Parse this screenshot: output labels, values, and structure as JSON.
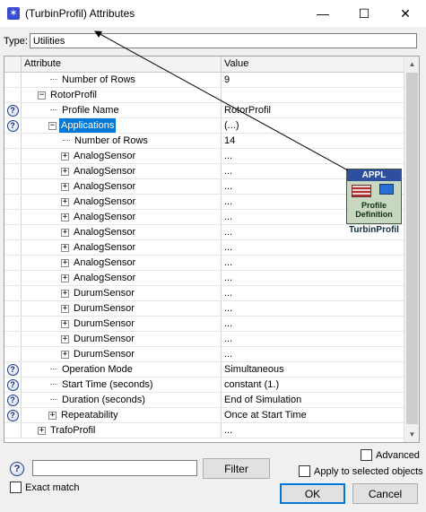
{
  "window": {
    "title": "(TurbinProfil) Attributes",
    "minimize": "—",
    "maximize": "☐",
    "close": "✕"
  },
  "type_row": {
    "label": "Type:",
    "value": "Utilities"
  },
  "grid": {
    "columns": {
      "attribute": "Attribute",
      "value": "Value"
    },
    "rows": [
      {
        "q": false,
        "indent": 3,
        "expander": "",
        "label": "Number of Rows",
        "value": "9",
        "selected": false
      },
      {
        "q": false,
        "indent": 2,
        "expander": "minus",
        "label": "RotorProfil",
        "value": "",
        "selected": false
      },
      {
        "q": true,
        "indent": 3,
        "expander": "",
        "label": "Profile Name",
        "value": "RotorProfil",
        "selected": false
      },
      {
        "q": true,
        "indent": 3,
        "expander": "minus",
        "label": "Applications",
        "value": "(...)",
        "selected": true
      },
      {
        "q": false,
        "indent": 4,
        "expander": "",
        "label": "Number of Rows",
        "value": "14",
        "selected": false
      },
      {
        "q": false,
        "indent": 4,
        "expander": "plus",
        "label": "AnalogSensor",
        "value": "...",
        "selected": false
      },
      {
        "q": false,
        "indent": 4,
        "expander": "plus",
        "label": "AnalogSensor",
        "value": "...",
        "selected": false
      },
      {
        "q": false,
        "indent": 4,
        "expander": "plus",
        "label": "AnalogSensor",
        "value": "...",
        "selected": false
      },
      {
        "q": false,
        "indent": 4,
        "expander": "plus",
        "label": "AnalogSensor",
        "value": "...",
        "selected": false
      },
      {
        "q": false,
        "indent": 4,
        "expander": "plus",
        "label": "AnalogSensor",
        "value": "...",
        "selected": false
      },
      {
        "q": false,
        "indent": 4,
        "expander": "plus",
        "label": "AnalogSensor",
        "value": "...",
        "selected": false
      },
      {
        "q": false,
        "indent": 4,
        "expander": "plus",
        "label": "AnalogSensor",
        "value": "...",
        "selected": false
      },
      {
        "q": false,
        "indent": 4,
        "expander": "plus",
        "label": "AnalogSensor",
        "value": "...",
        "selected": false
      },
      {
        "q": false,
        "indent": 4,
        "expander": "plus",
        "label": "AnalogSensor",
        "value": "...",
        "selected": false
      },
      {
        "q": false,
        "indent": 4,
        "expander": "plus",
        "label": "DurumSensor",
        "value": "...",
        "selected": false
      },
      {
        "q": false,
        "indent": 4,
        "expander": "plus",
        "label": "DurumSensor",
        "value": "...",
        "selected": false
      },
      {
        "q": false,
        "indent": 4,
        "expander": "plus",
        "label": "DurumSensor",
        "value": "...",
        "selected": false
      },
      {
        "q": false,
        "indent": 4,
        "expander": "plus",
        "label": "DurumSensor",
        "value": "...",
        "selected": false
      },
      {
        "q": false,
        "indent": 4,
        "expander": "plus",
        "label": "DurumSensor",
        "value": "...",
        "selected": false
      },
      {
        "q": true,
        "indent": 3,
        "expander": "",
        "label": "Operation Mode",
        "value": "Simultaneous",
        "selected": false
      },
      {
        "q": true,
        "indent": 3,
        "expander": "",
        "label": "Start Time (seconds)",
        "value": "constant (1.)",
        "selected": false
      },
      {
        "q": true,
        "indent": 3,
        "expander": "",
        "label": "Duration (seconds)",
        "value": "End of Simulation",
        "selected": false
      },
      {
        "q": true,
        "indent": 3,
        "expander": "plus",
        "label": "Repeatability",
        "value": "Once at Start Time",
        "selected": false
      },
      {
        "q": false,
        "indent": 2,
        "expander": "plus",
        "label": "TrafoProfil",
        "value": "...",
        "selected": false
      }
    ]
  },
  "node": {
    "header": "APPL",
    "line1": "Profile",
    "line2": "Definition",
    "caption": "TurbinProfil"
  },
  "bottom": {
    "filter_value": "",
    "filter_button": "Filter",
    "exact_match": "Exact match",
    "advanced": "Advanced",
    "apply_selected": "Apply to selected objects",
    "ok": "OK",
    "cancel": "Cancel"
  },
  "colors": {
    "selection": "#0078d7",
    "node_header": "#2e4fa0"
  }
}
